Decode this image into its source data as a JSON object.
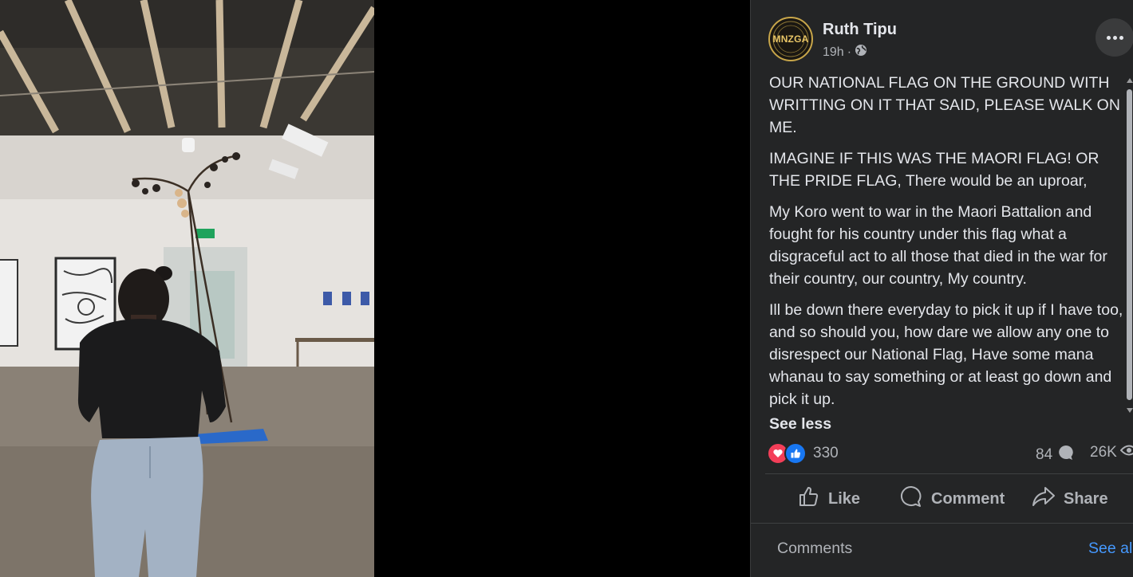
{
  "post": {
    "author": "Ruth Tipu",
    "avatar_text": "MNZGA",
    "time": "19h",
    "separator": "·",
    "audience_icon": "globe-icon",
    "paragraphs": [
      "OUR NATIONAL FLAG ON THE GROUND WITH WRITTING ON IT THAT SAID, PLEASE WALK ON ME.",
      "IMAGINE IF THIS WAS THE MAORI FLAG! OR THE PRIDE FLAG, There would be an uproar,",
      "My Koro went to war in the Maori Battalion and fought for his country under this flag what a disgraceful act to all those that died in the war for their country, our country, My country.",
      "Ill be down there everyday to pick it up if I have too, and so should you, how dare we allow any one to disrespect our National Flag, Have some mana whanau to say something or at least go down and pick it up."
    ],
    "see_less": "See less"
  },
  "stats": {
    "reactions": "330",
    "comments": "84",
    "views": "26K"
  },
  "actions": {
    "like": "Like",
    "comment": "Comment",
    "share": "Share"
  },
  "comments_section": {
    "label": "Comments",
    "see_all": "See all"
  },
  "colors": {
    "panel_bg": "#242526",
    "text": "#e4e6eb",
    "muted": "#b0b3b8",
    "link": "#4599ff",
    "love": "#f33e58",
    "like": "#1877f2"
  }
}
